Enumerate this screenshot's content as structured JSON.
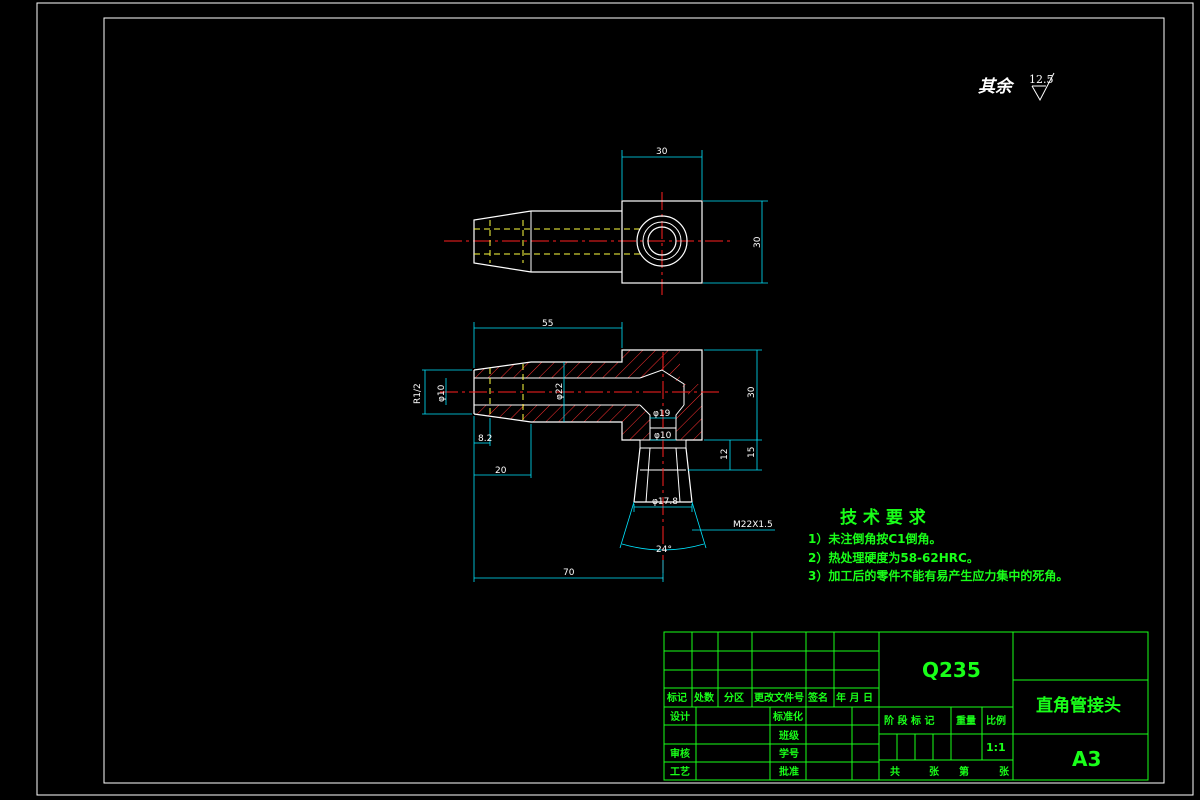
{
  "surface_mark": {
    "label": "其余",
    "value": "12.5"
  },
  "top_view": {
    "width_dim": "30",
    "height_dim": "30"
  },
  "section_view": {
    "len_55": "55",
    "thread": "R1/2",
    "dia_10a": "φ10",
    "dia_22": "φ22",
    "dia_19": "φ19",
    "dia_10b": "φ10",
    "dim_30": "30",
    "dim_12": "12",
    "dim_15": "15",
    "dim_8": "8.2",
    "dim_20": "20",
    "dia_17": "φ17.8",
    "thread_m": "M22X1.5",
    "angle": "24°",
    "len_70": "70"
  },
  "tech_req": {
    "title": "技 术 要 求",
    "items": [
      "1）未注倒角按C1倒角。",
      "2）热处理硬度为58-62HRC。",
      "3）加工后的零件不能有易产生应力集中的死角。"
    ]
  },
  "title_block": {
    "material": "Q235",
    "part_name": "直角管接头",
    "sheet": "A3",
    "scale": "1:1",
    "hdr": [
      "标记",
      "处数",
      "分区",
      "更改文件号",
      "签名",
      "年 月 日"
    ],
    "left_rows": [
      "设计",
      "审核",
      "工艺"
    ],
    "mid_rows": [
      "标准化",
      "班级",
      "学号",
      "批准"
    ],
    "right_hdr": [
      "阶 段 标 记",
      "重量",
      "比例"
    ],
    "bottom": [
      "共",
      "张",
      "第",
      "张"
    ]
  }
}
